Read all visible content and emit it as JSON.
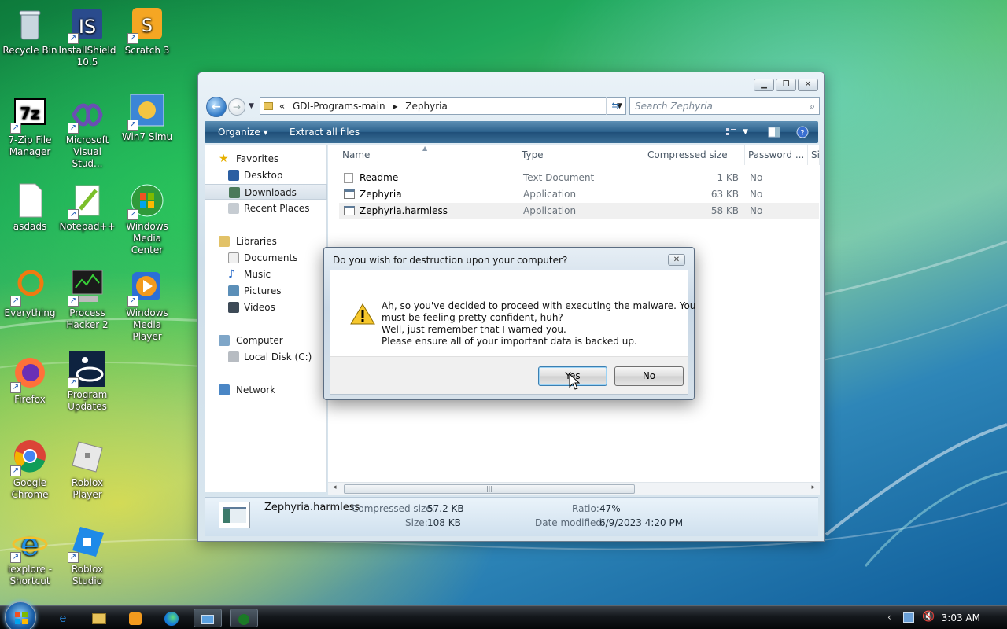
{
  "desktop": {
    "icons": [
      {
        "label": "Recycle Bin"
      },
      {
        "label": "InstallShield 10.5"
      },
      {
        "label": "Scratch 3"
      },
      {
        "label": "7-Zip File Manager"
      },
      {
        "label": "Microsoft Visual Stud..."
      },
      {
        "label": "Win7 Simu"
      },
      {
        "label": "asdads"
      },
      {
        "label": "Notepad++"
      },
      {
        "label": "Windows Media Center"
      },
      {
        "label": "Everything"
      },
      {
        "label": "Process Hacker 2"
      },
      {
        "label": "Windows Media Player"
      },
      {
        "label": "Firefox"
      },
      {
        "label": "Program Updates"
      },
      {
        "label": "Google Chrome"
      },
      {
        "label": "Roblox Player"
      },
      {
        "label": "iexplore - Shortcut"
      },
      {
        "label": "Roblox Studio"
      }
    ]
  },
  "explorer": {
    "address": {
      "prefix": "«",
      "segments": [
        "GDI-Programs-main",
        "Zephyria"
      ]
    },
    "search_placeholder": "Search Zephyria",
    "toolbar": {
      "organize": "Organize",
      "extract": "Extract all files"
    },
    "nav": {
      "favorites": "Favorites",
      "desktop": "Desktop",
      "downloads": "Downloads",
      "recent": "Recent Places",
      "libraries": "Libraries",
      "documents": "Documents",
      "music": "Music",
      "pictures": "Pictures",
      "videos": "Videos",
      "computer": "Computer",
      "localdisk": "Local Disk (C:)",
      "network": "Network"
    },
    "columns": {
      "name": "Name",
      "type": "Type",
      "csize": "Compressed size",
      "password": "Password ...",
      "size": "Si"
    },
    "files": [
      {
        "name": "Readme",
        "type": "Text Document",
        "csize": "1 KB",
        "password": "No"
      },
      {
        "name": "Zephyria",
        "type": "Application",
        "csize": "63 KB",
        "password": "No"
      },
      {
        "name": "Zephyria.harmless",
        "type": "Application",
        "csize": "58 KB",
        "password": "No"
      }
    ],
    "details": {
      "filename": "Zephyria.harmless",
      "csize_label": "Compressed size:",
      "csize": "57.2 KB",
      "size_label": "Size:",
      "size": "108 KB",
      "ratio_label": "Ratio:",
      "ratio": "47%",
      "date_label": "Date modified:",
      "date": "6/9/2023 4:20 PM"
    }
  },
  "dialog": {
    "title": "Do you wish for destruction upon your computer?",
    "lines": [
      "Ah, so you've decided to proceed with executing the malware. You",
      "must be feeling pretty confident, huh?",
      "Well, just remember that I warned you.",
      "Please ensure all of your important data is backed up."
    ],
    "yes": "Yes",
    "no": "No"
  },
  "taskbar": {
    "clock": "3:03 AM"
  },
  "colors": {
    "toolbar": "#2a5f8a",
    "selection": "#d7e1ea",
    "desktop_green": "#1fa85a"
  }
}
